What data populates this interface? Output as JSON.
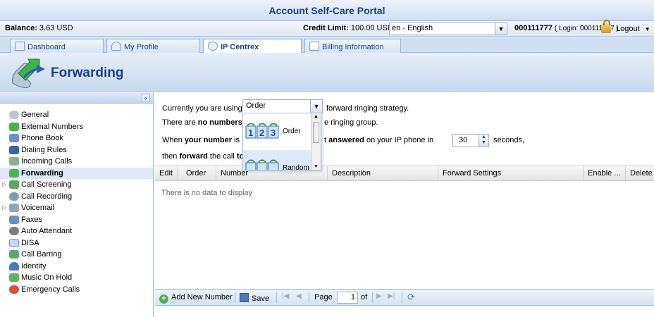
{
  "window": {
    "title": "Account Self-Care Portal"
  },
  "status": {
    "balance_label": "Balance:",
    "balance_value": "3.63 USD",
    "credit_label": "Credit Limit:",
    "credit_value": "100.00 USD",
    "language": "en - English",
    "account_id": "000111777",
    "login_text": "( Login: 000111777 )",
    "logout_label": "Logout"
  },
  "tabs": [
    {
      "label": "Dashboard"
    },
    {
      "label": "My Profile"
    },
    {
      "label": "IP Centrex",
      "active": true
    },
    {
      "label": "Billing Information"
    }
  ],
  "page": {
    "title": "Forwarding"
  },
  "sidebar": {
    "collapse_icon": "«",
    "items": [
      {
        "label": "General",
        "icon": "gear-icon"
      },
      {
        "label": "External Numbers",
        "icon": "numbers-icon"
      },
      {
        "label": "Phone Book",
        "icon": "phonebook-icon"
      },
      {
        "label": "Dialing Rules",
        "icon": "dialing-rules-icon"
      },
      {
        "label": "Incoming Calls",
        "icon": "incoming-calls-icon"
      },
      {
        "label": "Forwarding",
        "icon": "forwarding-icon",
        "active": true
      },
      {
        "label": "Call Screening",
        "icon": "call-screening-icon",
        "expandable": true
      },
      {
        "label": "Call Recording",
        "icon": "call-recording-icon"
      },
      {
        "label": "Voicemail",
        "icon": "voicemail-icon",
        "expandable": true
      },
      {
        "label": "Faxes",
        "icon": "fax-icon"
      },
      {
        "label": "Auto Attendant",
        "icon": "auto-attendant-icon"
      },
      {
        "label": "DISA",
        "icon": "disa-icon"
      },
      {
        "label": "Call Barring",
        "icon": "call-barring-icon"
      },
      {
        "label": "Identity",
        "icon": "identity-icon"
      },
      {
        "label": "Music On Hold",
        "icon": "music-icon"
      },
      {
        "label": "Emergency Calls",
        "icon": "emergency-icon"
      }
    ]
  },
  "form": {
    "line1_prefix": "Currently you are using",
    "strategy_value": "Order",
    "line1_suffix": "forward ringing strategy.",
    "line2_a": "There are",
    "line2_b": "no numbers",
    "line2_c": "e ringing group.",
    "line3_a": "When",
    "line3_b": "your number",
    "line3_c": "is (",
    "line3_d": "t",
    "line3_e": "answered",
    "line3_f": "on your IP phone in",
    "seconds_value": "30",
    "line3_g": "seconds,",
    "line4_a": "then",
    "line4_b": "forward",
    "line4_c": "the call",
    "line4_d": "to"
  },
  "strategy_options": [
    {
      "label": "Order",
      "icon": "order-123-icon"
    },
    {
      "label": "Random",
      "icon": "random-icon"
    }
  ],
  "grid": {
    "columns": [
      "Edit",
      "Order",
      "Number",
      "Description",
      "Forward Settings",
      "Enable ...",
      "Delete"
    ],
    "empty_text": "There is no data to display"
  },
  "toolbar": {
    "add_label": "Add New Number",
    "save_label": "Save",
    "page_label": "Page",
    "page_value": "1",
    "of_label": "of"
  }
}
